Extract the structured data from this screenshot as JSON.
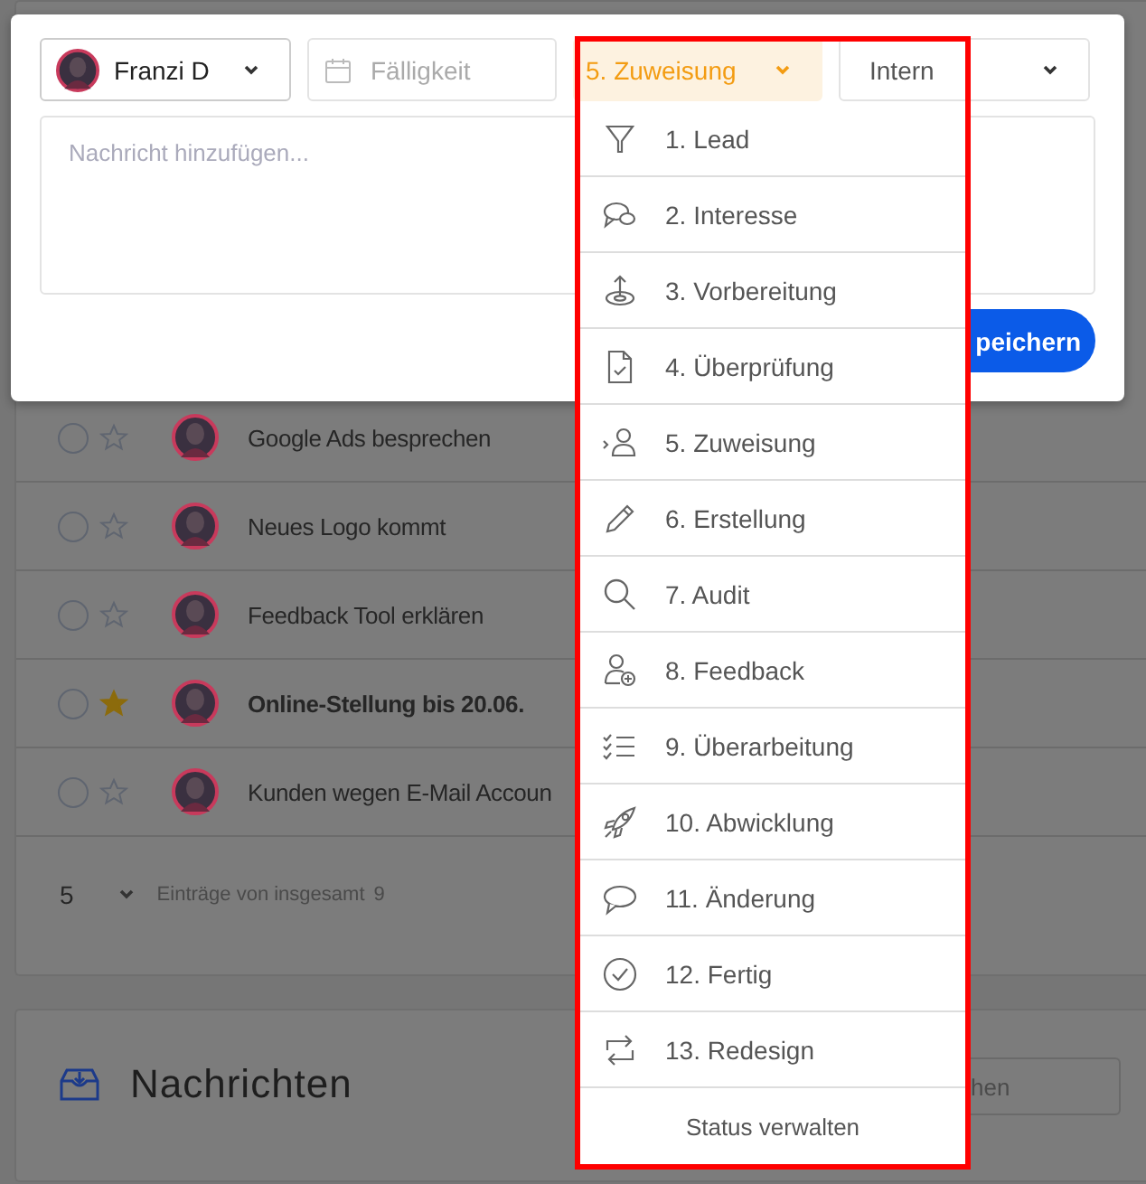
{
  "modal": {
    "assignee": {
      "name": "Franzi D"
    },
    "due_date": {
      "placeholder": "Fälligkeit"
    },
    "status": {
      "value": "5. Zuweisung",
      "expanded": true
    },
    "visibility": {
      "value": "Intern"
    },
    "message": {
      "placeholder": "Nachricht hinzufügen..."
    },
    "save_button": "peichern"
  },
  "status_menu": {
    "items": [
      {
        "label": "1. Lead"
      },
      {
        "label": "2. Interesse"
      },
      {
        "label": "3. Vorbereitung"
      },
      {
        "label": "4. Überprüfung"
      },
      {
        "label": "5. Zuweisung"
      },
      {
        "label": "6. Erstellung"
      },
      {
        "label": "7. Audit"
      },
      {
        "label": "8. Feedback"
      },
      {
        "label": "9. Überarbeitung"
      },
      {
        "label": "10. Abwicklung"
      },
      {
        "label": "11. Änderung"
      },
      {
        "label": "12. Fertig"
      },
      {
        "label": "13. Redesign"
      }
    ],
    "footer": "Status verwalten"
  },
  "tasks": {
    "rows": [
      {
        "title": "Google Ads besprechen",
        "done": false,
        "starred": false,
        "important": false
      },
      {
        "title": "Neues Logo kommt",
        "done": false,
        "starred": false,
        "important": false
      },
      {
        "title": "Feedback Tool erklären",
        "done": false,
        "starred": false,
        "important": false
      },
      {
        "title": "Online-Stellung bis 20.06.",
        "done": false,
        "starred": true,
        "important": true
      },
      {
        "title": "Kunden wegen E-Mail Accoun",
        "done": false,
        "starred": false,
        "important": false
      }
    ],
    "page_size": "5",
    "summary": "Einträge von insgesamt",
    "total": "9"
  },
  "messages": {
    "title": "Nachrichten",
    "search": {
      "placeholder": "hen"
    }
  }
}
